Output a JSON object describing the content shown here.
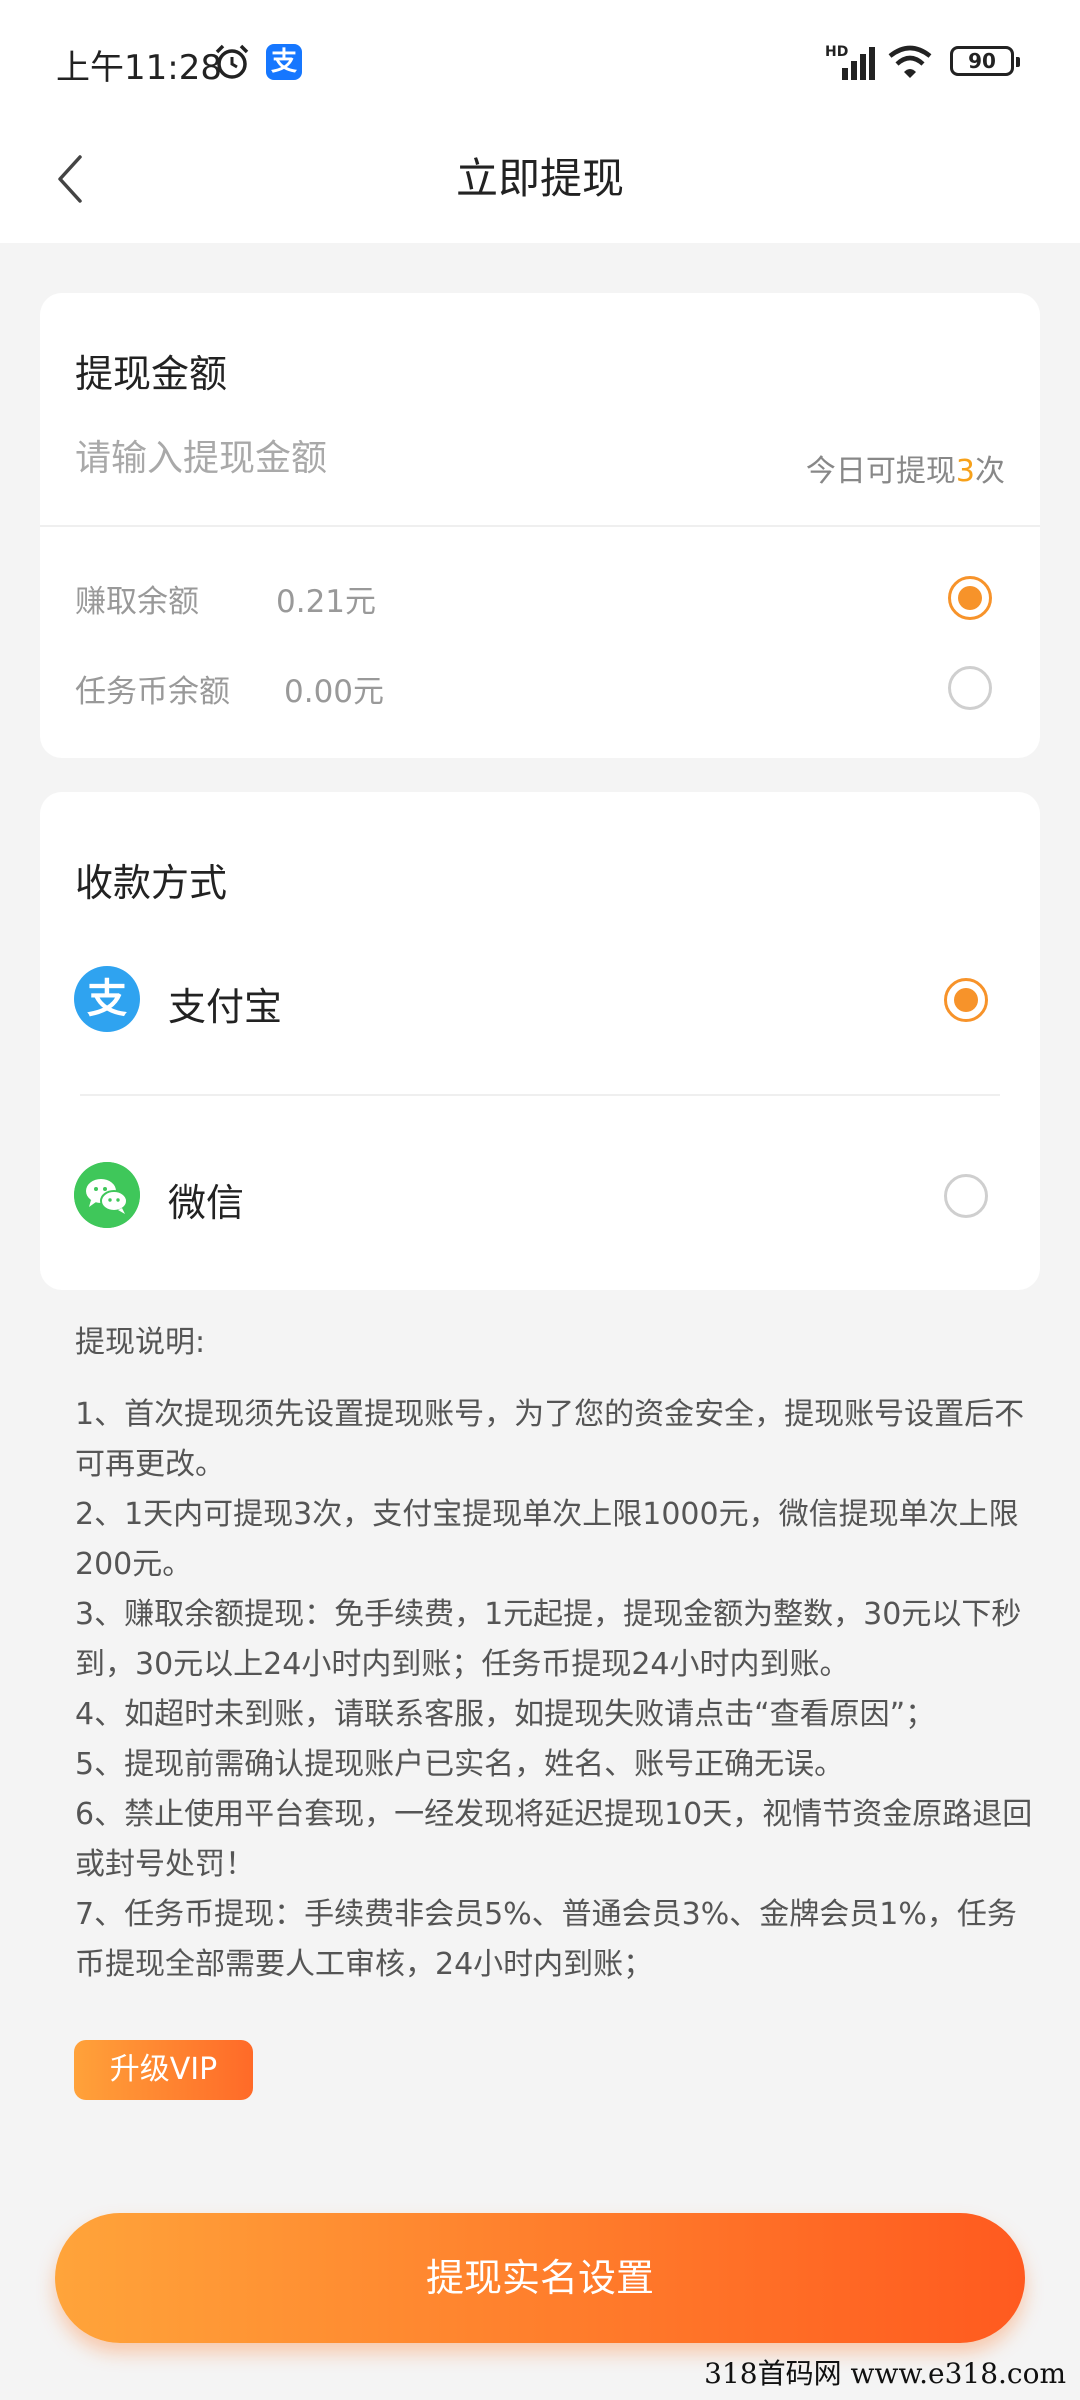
{
  "status_bar": {
    "time": "上午11:28",
    "alipay_glyph": "支",
    "network_label": "HD",
    "battery": "90"
  },
  "navbar": {
    "title": "立即提现",
    "back_icon": "chevron-left-icon"
  },
  "amount_card": {
    "title": "提现金额",
    "input_placeholder": "请输入提现金额",
    "input_value": "",
    "limit_prefix": "今日可提现",
    "limit_count": "3",
    "limit_suffix": "次",
    "balances": [
      {
        "label": "赚取余额",
        "value": "0.21元",
        "selected": true
      },
      {
        "label": "任务币余额",
        "value": "0.00元",
        "selected": false
      }
    ]
  },
  "payment_card": {
    "title": "收款方式",
    "methods": [
      {
        "label": "支付宝",
        "icon": "alipay-icon",
        "icon_glyph": "支",
        "selected": true
      },
      {
        "label": "微信",
        "icon": "wechat-icon",
        "selected": false
      }
    ]
  },
  "notes": {
    "title": "提现说明:",
    "items": [
      "1、首次提现须先设置提现账号，为了您的资金安全，提现账号设置后不可再更改。",
      "2、1天内可提现3次，支付宝提现单次上限1000元，微信提现单次上限200元。",
      "3、赚取余额提现：免手续费，1元起提，提现金额为整数，30元以下秒到，30元以上24小时内到账；任务币提现24小时内到账。",
      "4、如超时未到账，请联系客服，如提现失败请点击“查看原因”；",
      "5、提现前需确认提现账户已实名，姓名、账号正确无误。",
      "6、禁止使用平台套现，一经发现将延迟提现10天，视情节资金原路退回或封号处罚！",
      "7、任务币提现：手续费非会员5%、普通会员3%、金牌会员1%，任务币提现全部需要人工审核，24小时内到账；"
    ]
  },
  "vip_button": "升级VIP",
  "submit_button": "提现实名设置",
  "watermark": "318首码网  www.e318.com",
  "colors": {
    "accent": "#f7932a",
    "alipay": "#2fa3f0",
    "wechat": "#3fc75a"
  }
}
